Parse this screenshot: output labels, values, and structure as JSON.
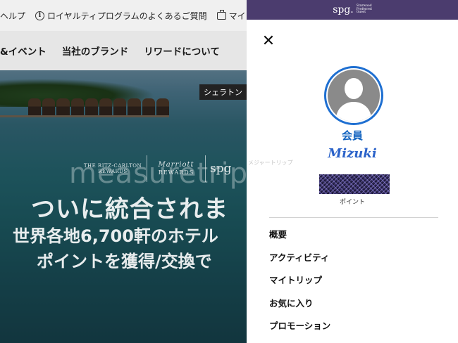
{
  "background_page": {
    "utility_bar": {
      "help_label": "ヘルプ",
      "loyalty_faq_label": "ロイヤルティプログラムのよくあるご質問",
      "my_trips_label": "マイ"
    },
    "main_nav": {
      "items": [
        "&イベント",
        "当社のブランド",
        "リワードについて"
      ]
    },
    "hero": {
      "property_tag": "シェラトン",
      "logos": {
        "ritz": "THE RITZ-CARLTON\nREWARDS",
        "marriott_script": "Marriott",
        "marriott_rewards": "REWARDS",
        "spg": "spg"
      },
      "headline_1": "ついに統合されま",
      "headline_2": "世界各地6,700軒のホテル",
      "headline_3": "ポイントを獲得/交換で"
    },
    "watermark": "measuretrip.com",
    "watermark_kana": "メジャートリップ"
  },
  "drawer": {
    "header": {
      "brand": "spg.",
      "brand_sub": "Starwood\nPreferred\nGuest"
    },
    "close_glyph": "✕",
    "member_label": "会員",
    "member_name": "Mizuki",
    "points_label": "ポイント",
    "menu": [
      "概要",
      "アクティビティ",
      "マイトリップ",
      "お気に入り",
      "プロモーション"
    ]
  },
  "colors": {
    "drawer_header": "#4b3c6e",
    "accent_blue": "#1565c0"
  }
}
